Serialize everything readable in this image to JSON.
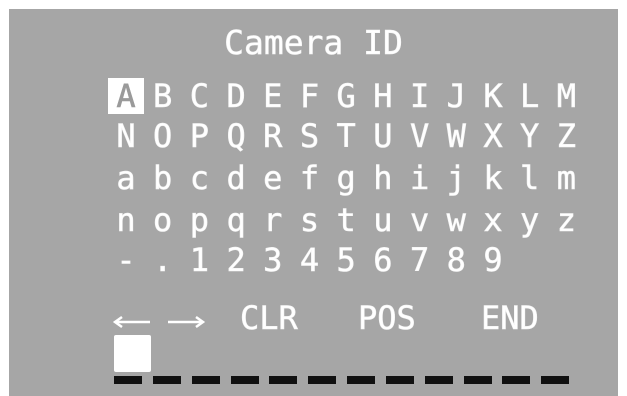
{
  "title": "Camera ID",
  "grid": {
    "rows": [
      [
        "A",
        "B",
        "C",
        "D",
        "E",
        "F",
        "G",
        "H",
        "I",
        "J",
        "K",
        "L",
        "M"
      ],
      [
        "N",
        "O",
        "P",
        "Q",
        "R",
        "S",
        "T",
        "U",
        "V",
        "W",
        "X",
        "Y",
        "Z"
      ],
      [
        "a",
        "b",
        "c",
        "d",
        "e",
        "f",
        "g",
        "h",
        "i",
        "j",
        "k",
        "l",
        "m"
      ],
      [
        "n",
        "o",
        "p",
        "q",
        "r",
        "s",
        "t",
        "u",
        "v",
        "w",
        "x",
        "y",
        "z"
      ],
      [
        "-",
        ".",
        "1",
        "2",
        "3",
        "4",
        "5",
        "6",
        "7",
        "8",
        "9"
      ]
    ],
    "selected": "A"
  },
  "controls": {
    "left_arrow_icon": "arrow-left-icon",
    "right_arrow_icon": "arrow-right-icon",
    "clear_label": "CLR",
    "position_label": "POS",
    "end_label": "END"
  },
  "entry": {
    "value": "",
    "slots": 12
  },
  "colors": {
    "osd_background": "#a6a6a6",
    "text": "#ffffff",
    "selection": "#ffffff",
    "underline": "#111111"
  }
}
